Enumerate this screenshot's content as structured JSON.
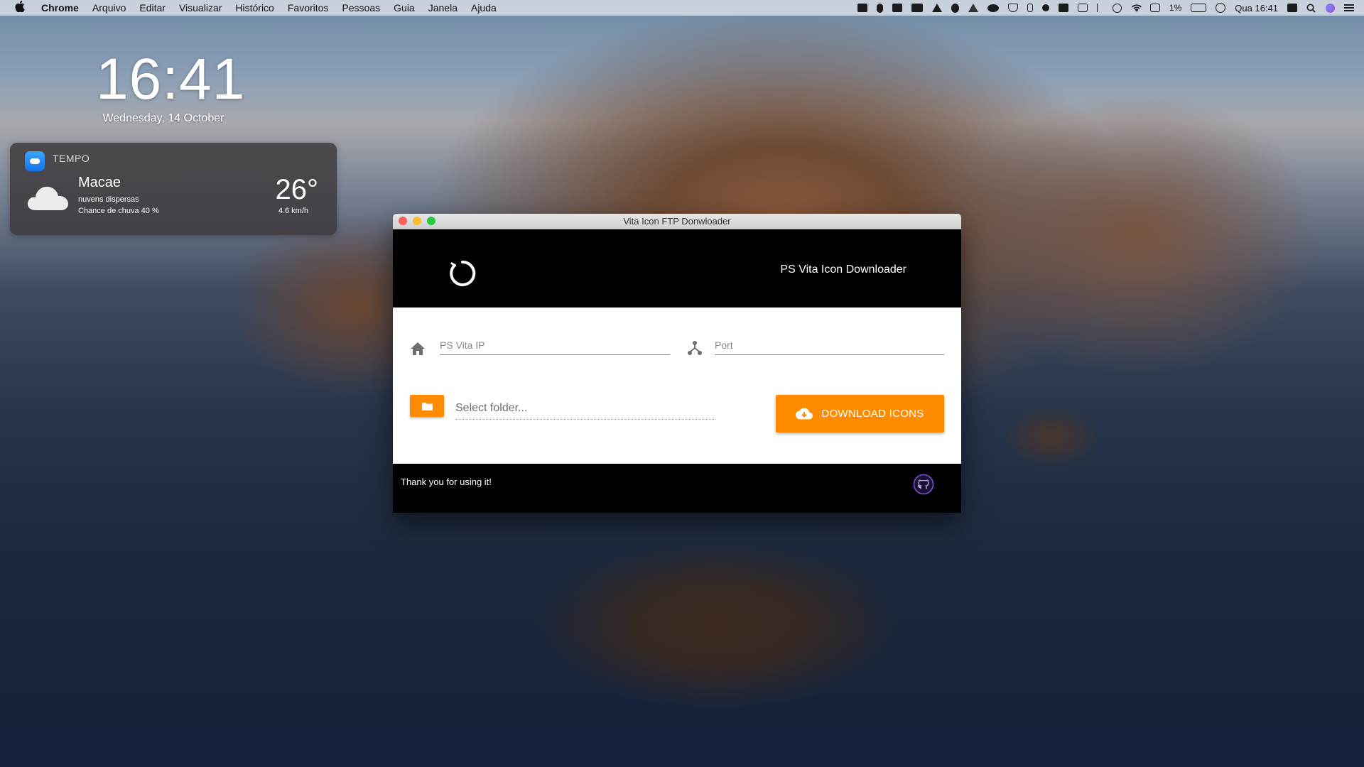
{
  "menubar": {
    "app": "Chrome",
    "items": [
      "Arquivo",
      "Editar",
      "Visualizar",
      "Histórico",
      "Favoritos",
      "Pessoas",
      "Guia",
      "Janela",
      "Ajuda"
    ],
    "battery": "1%",
    "clock": "Qua 16:41"
  },
  "desktop_clock": {
    "time": "16:41",
    "date": "Wednesday, 14 October"
  },
  "weather": {
    "app_name": "TEMPO",
    "city": "Macae",
    "condition": "nuvens dispersas",
    "rain": "Chance de chuva 40 %",
    "temperature": "26°",
    "wind": "4.6 km/h"
  },
  "window": {
    "title": "Vita Icon FTP Donwloader",
    "header_title": "PS Vita Icon Downloader",
    "ip_placeholder": "PS Vita IP",
    "port_placeholder": "Port",
    "folder_placeholder": "Select folder...",
    "download_label": "DOWNLOAD ICONS",
    "footer_text": "Thank you for using it!"
  },
  "colors": {
    "accent": "#ff8c00",
    "header_bg": "#000000",
    "github_ring": "#7b4fd6"
  }
}
